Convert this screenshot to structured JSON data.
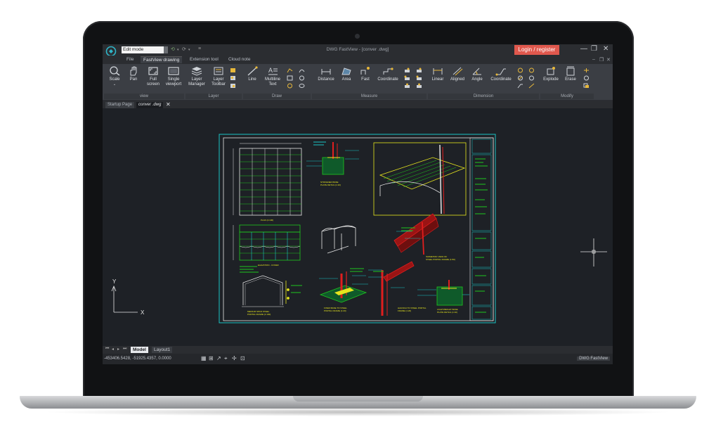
{
  "window": {
    "title": "DWG FastView - [conver .dwg]",
    "mode": "Edit mode",
    "login_label": "Login / register"
  },
  "menu": {
    "items": [
      "File",
      "FastView drawing",
      "Extension tool",
      "Cloud note"
    ]
  },
  "ribbon": {
    "groups": [
      "view",
      "Layer",
      "Draw",
      "Measure",
      "Dimension",
      "Modify"
    ],
    "tools": {
      "scale": "Scale",
      "pan": "Pan",
      "full": "Full",
      "full2": "screen",
      "single": "Single",
      "single2": "viewport",
      "layer_manager": "Layer",
      "layer_manager2": "Manager",
      "layer_toolbar": "Layer",
      "layer_toolbar2": "Toolbar",
      "line": "Line",
      "mtext": "Multiline",
      "mtext2": "Text",
      "distance": "Distance",
      "area": "Area",
      "fast": "Fast",
      "coordinate": "Coordinate",
      "linear": "Linear",
      "aligned": "Aligned",
      "angle": "Angle",
      "dim_coordinate": "Coordinate",
      "explode": "Explode",
      "erase": "Erase"
    }
  },
  "doc_tabs": [
    "Startup Page",
    "conver .dwg"
  ],
  "drawing": {
    "labels": {
      "plan": "PLAN (1:100)",
      "elevation": "ELEVATION - COVER",
      "stiffened": "STIFFENED BASE",
      "stiffened2": "PLATE DETAIL (1:10)",
      "medium_span": "MEDIUM SPAN STEEL",
      "medium_span2": "PORTAL FRAME (1:100)",
      "fixed_base": "FIXED BASE TO STEEL",
      "fixed_base2": "PORTAL FRAME (1:20)",
      "haunch": "HAUNCH TO STEEL PORTAL",
      "haunch2": "FRAME (1:20)",
      "isometric": "ISOMETRIC VIEW OF",
      "isometric2": "STEEL PORTAL FRAME (1:50)",
      "lightweight": "LIGHTWEIGHT BASE",
      "lightweight2": "PLATE DETAIL (1:10)"
    },
    "ucs": {
      "y": "Y",
      "x": "X"
    }
  },
  "layout_tabs": [
    "Model",
    "Layout1"
  ],
  "status": {
    "coords": "-453406.5428, -51925.4357, 0.0000",
    "app": "DWG FastView"
  },
  "colors": {
    "accent": "#e0584d",
    "canvas": "#1e2126",
    "cad_cyan": "#19c4c4",
    "cad_red": "#e11e1e",
    "cad_yellow": "#e6e61e",
    "cad_green": "#1ec81e"
  }
}
